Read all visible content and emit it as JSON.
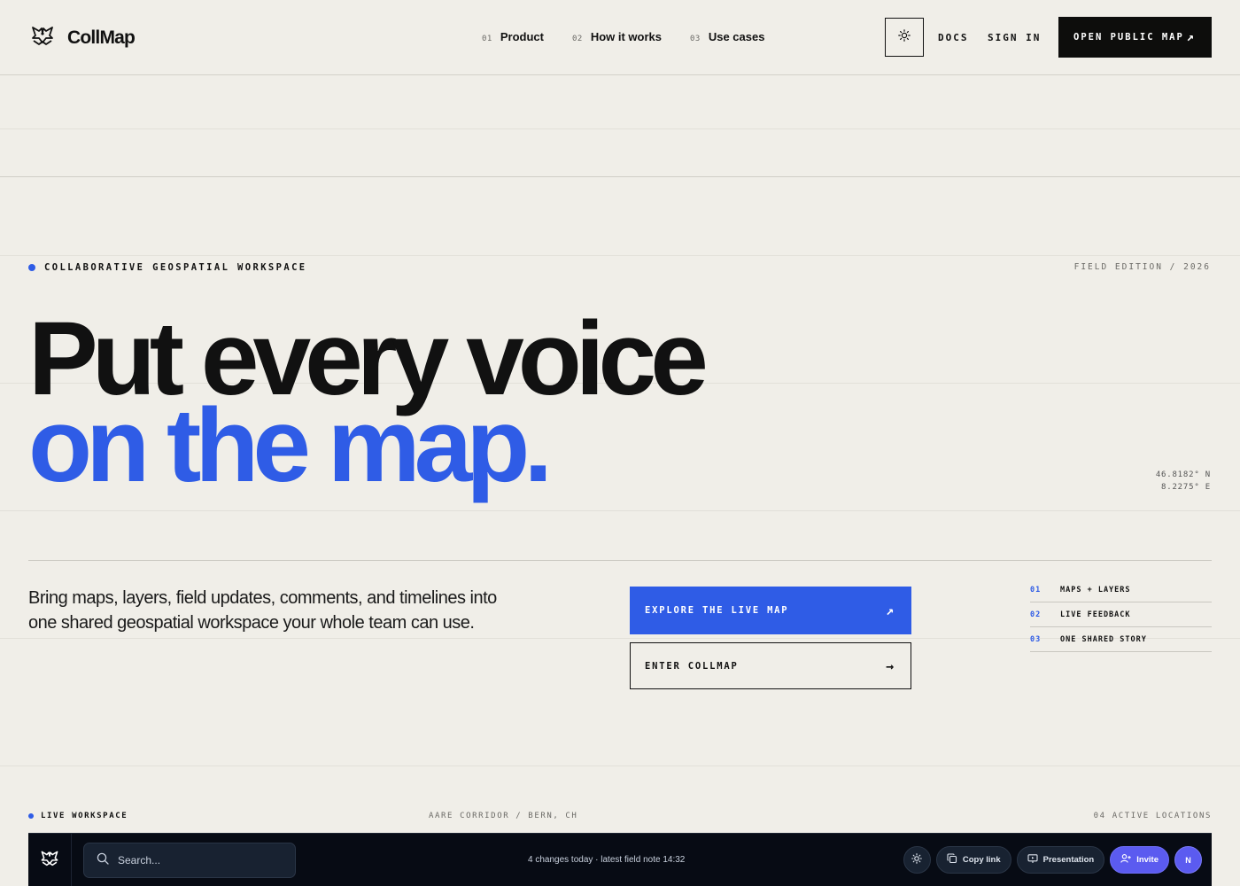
{
  "header": {
    "brand": "CollMap",
    "nav": [
      {
        "num": "01",
        "label": "Product"
      },
      {
        "num": "02",
        "label": "How it works"
      },
      {
        "num": "03",
        "label": "Use cases"
      }
    ],
    "docs_label": "DOCS",
    "signin_label": "SIGN IN",
    "open_map_label": "OPEN PUBLIC MAP",
    "open_map_icon": "↗"
  },
  "hero": {
    "eyebrow": "COLLABORATIVE GEOSPATIAL WORKSPACE",
    "edition": "FIELD EDITION / 2026",
    "headline_line1": "Put every voice",
    "headline_line2": "on the map.",
    "coords_lat": "46.8182° N",
    "coords_lon": "8.2275° E",
    "lede": "Bring maps, layers, field updates, comments, and timelines into one shared geospatial workspace your whole team can use.",
    "primary_cta": "EXPLORE THE LIVE MAP",
    "primary_cta_icon": "↗",
    "secondary_cta": "ENTER COLLMAP",
    "secondary_cta_icon": "→",
    "features": [
      {
        "num": "01",
        "label": "MAPS + LAYERS"
      },
      {
        "num": "02",
        "label": "LIVE FEEDBACK"
      },
      {
        "num": "03",
        "label": "ONE SHARED STORY"
      }
    ]
  },
  "workspace": {
    "live_label": "LIVE WORKSPACE",
    "location": "AARE CORRIDOR / BERN, CH",
    "count": "04 ACTIVE LOCATIONS",
    "search_placeholder": "Search...",
    "status": "4 changes today · latest field note 14:32",
    "copy_link": "Copy link",
    "presentation": "Presentation",
    "invite": "Invite",
    "avatar_initial": "N"
  },
  "colors": {
    "accent": "#2f5ce6",
    "background": "#f0eee8",
    "ink": "#111111",
    "app_bg": "#070b14",
    "invite": "#5b5bf0"
  },
  "icons": [
    "logo-icon",
    "sun-icon",
    "arrow-up-right-icon",
    "arrow-right-icon",
    "search-icon",
    "copy-icon",
    "presentation-icon",
    "user-plus-icon"
  ]
}
